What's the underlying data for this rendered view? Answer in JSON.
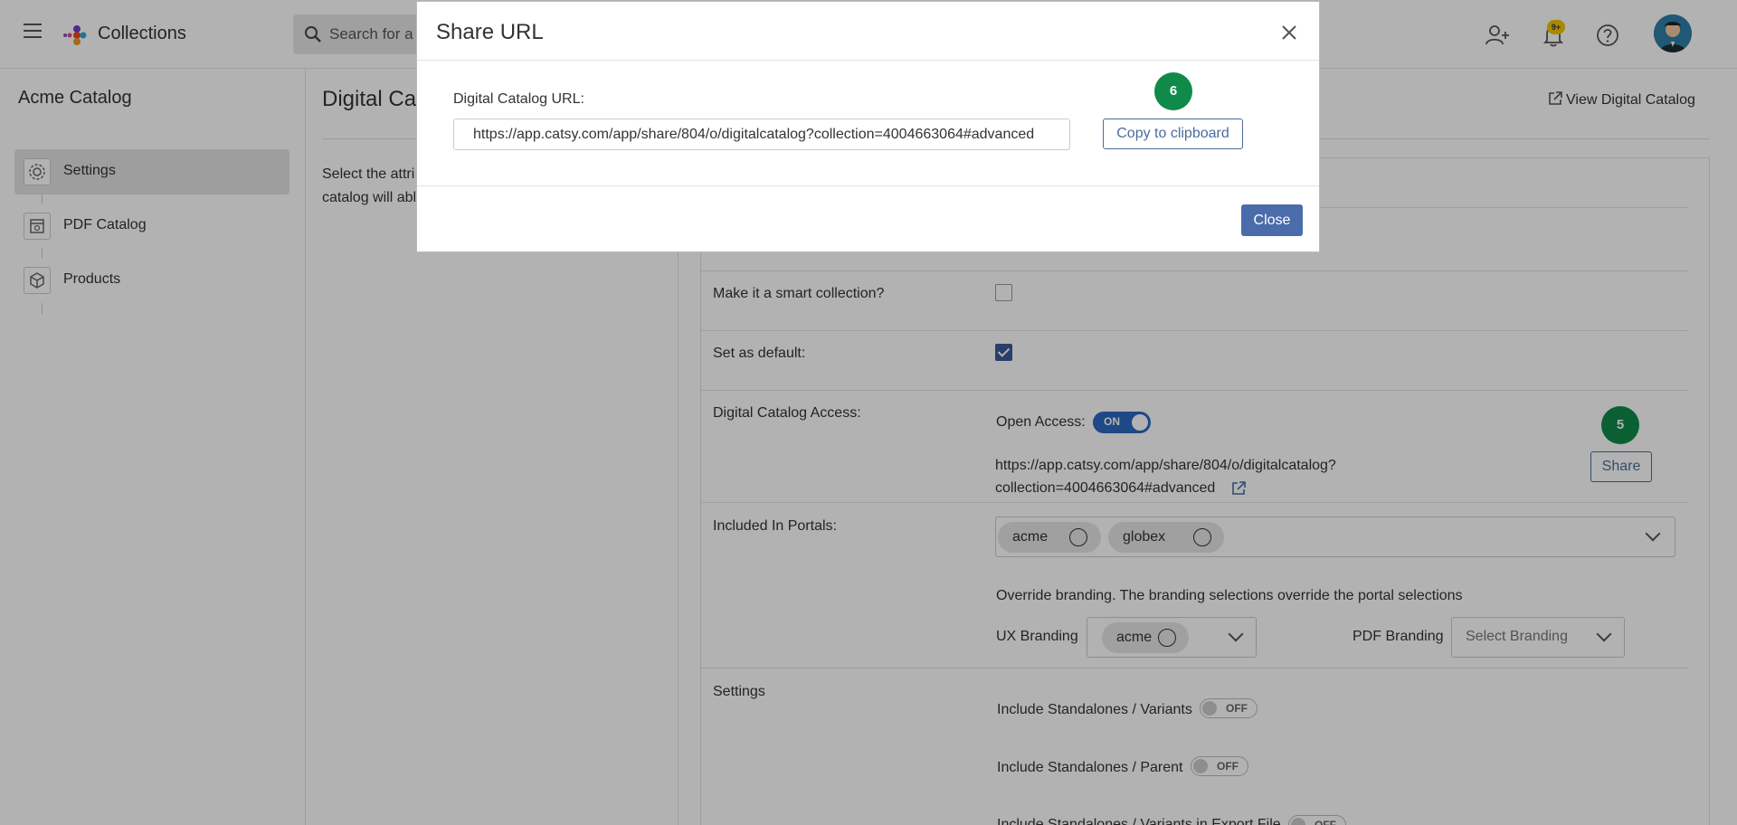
{
  "header": {
    "app_title": "Collections",
    "search_placeholder": "Search for a",
    "notification_badge": "9+"
  },
  "sidebar": {
    "title": "Acme Catalog",
    "items": [
      {
        "label": "Settings",
        "icon": "gear-icon",
        "active": true
      },
      {
        "label": "PDF Catalog",
        "icon": "pdf-catalog-icon",
        "active": false
      },
      {
        "label": "Products",
        "icon": "cube-icon",
        "active": false
      }
    ]
  },
  "main": {
    "title": "Digital Ca",
    "view_link": "View Digital Catalog",
    "desc_line1": "Select the attri",
    "desc_line2": "catalog will abl"
  },
  "form": {
    "smart_collection_label": "Make it a smart collection?",
    "smart_collection_checked": false,
    "set_default_label": "Set as default:",
    "set_default_checked": true,
    "access_label": "Digital Catalog Access:",
    "open_access_label": "Open Access:",
    "open_access_toggle": "ON",
    "catalog_url_line1": "https://app.catsy.com/app/share/804/o/digitalcatalog?",
    "catalog_url_line2": "collection=4004663064#advanced",
    "share_button": "Share",
    "share_step": "5",
    "portals_label": "Included In Portals:",
    "portals": [
      "acme",
      "globex"
    ],
    "override_text": "Override branding. The branding selections override the portal selections",
    "ux_branding_label": "UX Branding",
    "ux_branding_value": "acme",
    "pdf_branding_label": "PDF Branding",
    "pdf_branding_placeholder": "Select Branding",
    "settings_label": "Settings",
    "include_variants_label": "Include Standalones / Variants",
    "include_parent_label": "Include Standalones / Parent",
    "include_export_label": "Include Standalones / Variants in Export File",
    "toggle_off_label": "OFF"
  },
  "modal": {
    "title": "Share URL",
    "url_label": "Digital Catalog URL:",
    "url_value": "https://app.catsy.com/app/share/804/o/digitalcatalog?collection=4004663064#advanced",
    "copy_button": "Copy to clipboard",
    "copy_step": "6",
    "close_button": "Close"
  },
  "colors": {
    "accent": "#4a6cab",
    "step_green": "#0f8a49",
    "toggle_on": "#2c67c1",
    "badge": "#f2c500"
  }
}
